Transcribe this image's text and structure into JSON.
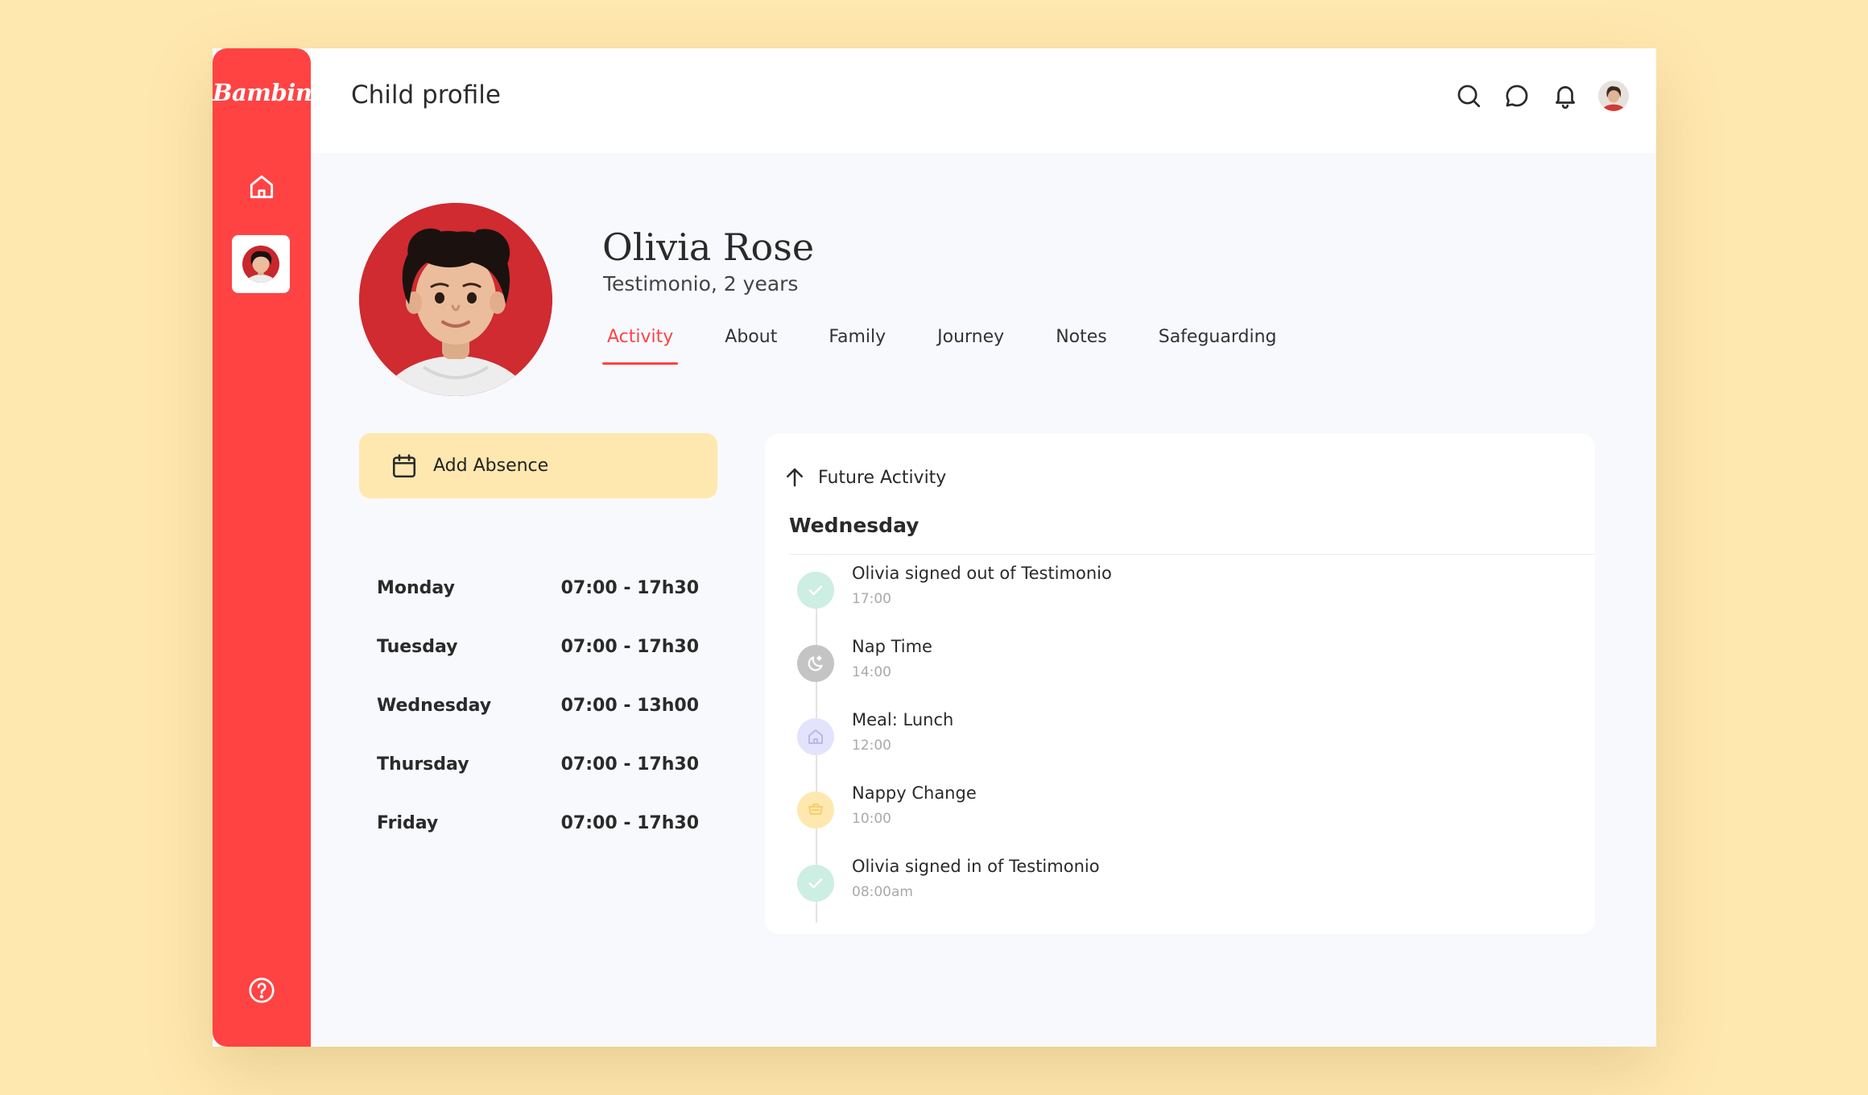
{
  "app": {
    "brand": "Bambin"
  },
  "header": {
    "title": "Child profile"
  },
  "profile": {
    "name": "Olivia Rose",
    "subtitle": "Testimonio, 2 years"
  },
  "tabs": [
    {
      "label": "Activity",
      "active": true
    },
    {
      "label": "About",
      "active": false
    },
    {
      "label": "Family",
      "active": false
    },
    {
      "label": "Journey",
      "active": false
    },
    {
      "label": "Notes",
      "active": false
    },
    {
      "label": "Safeguarding",
      "active": false
    }
  ],
  "absence": {
    "label": "Add Absence"
  },
  "schedule": [
    {
      "day": "Monday",
      "hours": "07:00 - 17h30"
    },
    {
      "day": "Tuesday",
      "hours": "07:00 - 17h30"
    },
    {
      "day": "Wednesday",
      "hours": "07:00 - 13h00"
    },
    {
      "day": "Thursday",
      "hours": "07:00 - 17h30"
    },
    {
      "day": "Friday",
      "hours": "07:00 - 17h30"
    }
  ],
  "activity": {
    "heading": "Future Activity",
    "day": "Wednesday",
    "events": [
      {
        "title": "Olivia signed out of Testimonio",
        "time": "17:00",
        "icon": "check-icon",
        "color": "#cdeee2"
      },
      {
        "title": "Nap Time",
        "time": "14:00",
        "icon": "moon-icon",
        "color": "#c4c4c4"
      },
      {
        "title": "Meal: Lunch",
        "time": "12:00",
        "icon": "meal-icon",
        "color": "#e3e3fb"
      },
      {
        "title": "Nappy Change",
        "time": "10:00",
        "icon": "nappy-icon",
        "color": "#ffe8af"
      },
      {
        "title": "Olivia signed in of Testimonio",
        "time": "08:00am",
        "icon": "check-icon",
        "color": "#cdeee2"
      }
    ]
  },
  "colors": {
    "accent": "#ff4343",
    "cream": "#ffe8af",
    "background": "#f8f9fd"
  }
}
